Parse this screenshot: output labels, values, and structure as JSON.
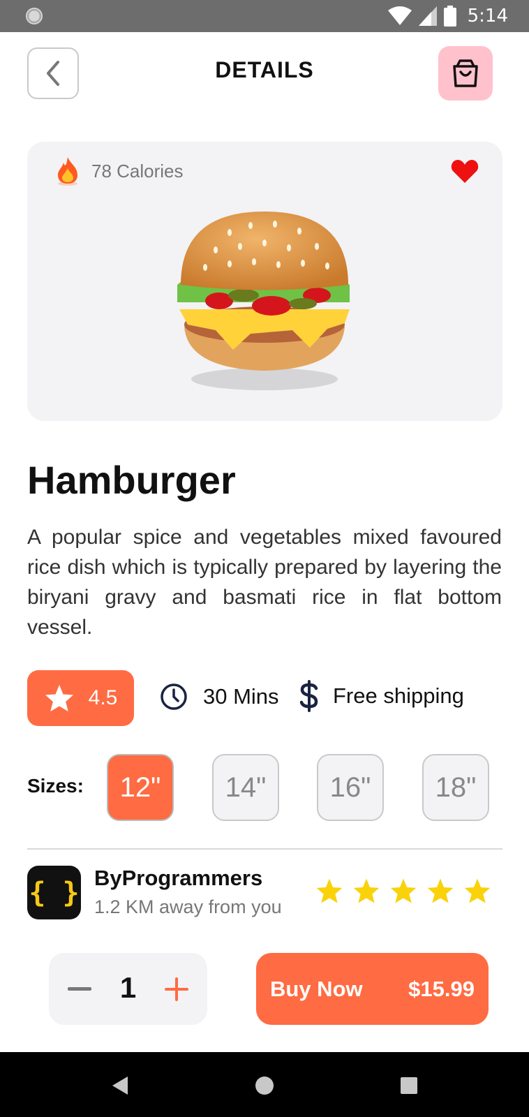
{
  "status_bar": {
    "time": "5:14"
  },
  "header": {
    "title": "DETAILS"
  },
  "product": {
    "calories": "78 Calories",
    "name": "Hamburger",
    "description": "A popular spice and vegetables mixed favoured rice dish which is typically prepared by layering the biryani gravy and basmati rice in flat bottom vessel.",
    "rating": "4.5",
    "time": "30 Mins",
    "shipping": "Free shipping"
  },
  "sizes": {
    "label": "Sizes:",
    "options": [
      "12\"",
      "14\"",
      "16\"",
      "18\""
    ],
    "selected": "12\""
  },
  "seller": {
    "logo_text": "{ }",
    "name": "ByProgrammers",
    "distance": "1.2 KM away from you",
    "stars": 5
  },
  "cart": {
    "quantity": "1"
  },
  "buy": {
    "label": "Buy Now",
    "price": "$15.99"
  },
  "colors": {
    "accent": "#ff6b42",
    "cart_bg": "#ffc2cd",
    "heart": "#ee1111",
    "star": "#f9d20a",
    "card_bg": "#f3f3f6"
  },
  "icons": {
    "back": "chevron-left-icon",
    "cart": "shopping-bag-icon",
    "calories": "fire-icon",
    "favorite": "heart-icon",
    "rating": "star-icon",
    "time": "clock-icon",
    "shipping": "dollar-icon",
    "decrease": "minus-icon",
    "increase": "plus-icon"
  }
}
